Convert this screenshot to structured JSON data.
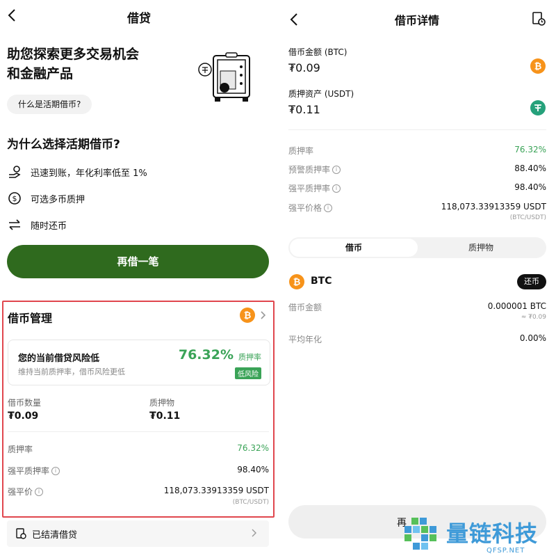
{
  "left": {
    "header_title": "借贷",
    "hero_line1": "助您探索更多交易机会",
    "hero_line2": "和金融产品",
    "faq_button": "什么是活期借币?",
    "why_title": "为什么选择活期借币?",
    "features": [
      "迅速到账，年化利率低至 1%",
      "可选多币质押",
      "随时还币"
    ],
    "borrow_again_button": "再借一笔",
    "management": {
      "title": "借币管理",
      "risk_title": "您的当前借贷风险低",
      "risk_sub": "维持当前质押率，借币风险更低",
      "risk_value": "76.32%",
      "risk_value_label": "质押率",
      "risk_badge": "低风险",
      "borrow_qty_label": "借币数量",
      "borrow_qty_value": "₮0.09",
      "collateral_label": "质押物",
      "collateral_value": "₮0.11",
      "rows": [
        {
          "label": "质押率",
          "value": "76.32%"
        },
        {
          "label": "强平质押率",
          "value": "98.40%"
        },
        {
          "label": "强平价",
          "value": "118,073.33913359 USDT"
        }
      ],
      "pair_note": "(BTC/USDT)"
    },
    "settled_label": "已结清借贷"
  },
  "right": {
    "header_title": "借币详情",
    "borrow_amount_label": "借币金额 (BTC)",
    "borrow_amount_value": "₮0.09",
    "collateral_label": "质押资产 (USDT)",
    "collateral_value": "₮0.11",
    "stats": [
      {
        "label": "质押率",
        "value": "76.32%"
      },
      {
        "label": "预警质押率",
        "value": "88.40%"
      },
      {
        "label": "强平质押率",
        "value": "98.40%"
      },
      {
        "label": "强平价格",
        "value": "118,073.33913359 USDT"
      }
    ],
    "pair_note": "(BTC/USDT)",
    "tabs": [
      "借币",
      "质押物"
    ],
    "coin_name": "BTC",
    "repay_button": "还币",
    "detail_rows": [
      {
        "label": "借币金额",
        "value": "0.000001 BTC"
      },
      {
        "label": "平均年化",
        "value": "0.00%"
      }
    ],
    "approx_value": "≈ ₮0.09",
    "bottom_button_partial": "再"
  },
  "watermark": {
    "text": "量链科技",
    "sub": "QFSP.NET"
  },
  "colors": {
    "accent_green": "#2f6a1e",
    "positive": "#3aa357",
    "btc_orange": "#f7931a",
    "usdt_teal": "#26a17b",
    "highlight_border": "#e0464d"
  }
}
